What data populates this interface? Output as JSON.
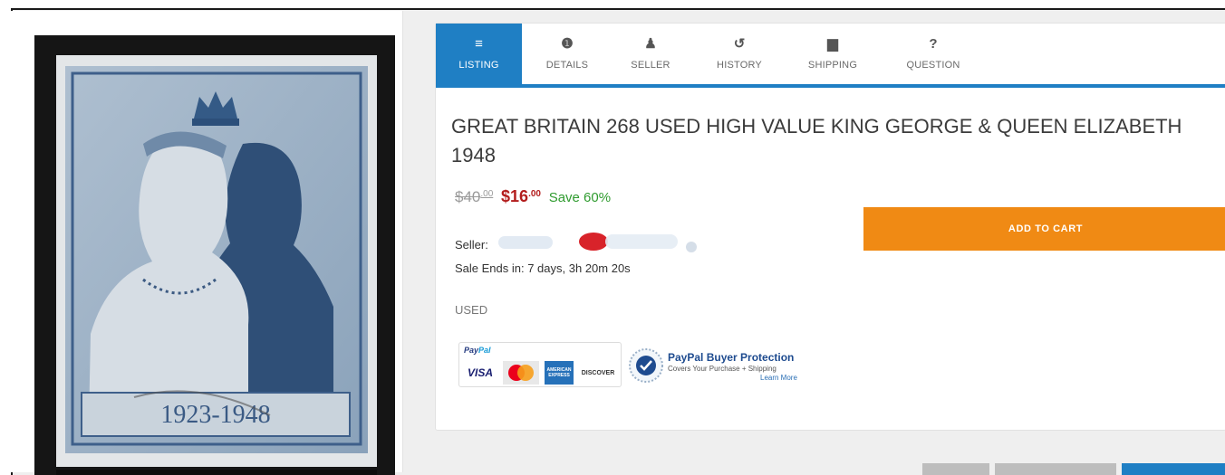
{
  "tabs": [
    {
      "label": "LISTING",
      "icon": "list-icon",
      "glyph": "≡"
    },
    {
      "label": "DETAILS",
      "icon": "info-icon",
      "glyph": "❶"
    },
    {
      "label": "SELLER",
      "icon": "person-icon",
      "glyph": "♟"
    },
    {
      "label": "HISTORY",
      "icon": "history-icon",
      "glyph": "↺"
    },
    {
      "label": "SHIPPING",
      "icon": "truck-icon",
      "glyph": "▆"
    },
    {
      "label": "QUESTION",
      "icon": "question-icon",
      "glyph": "?"
    }
  ],
  "listing": {
    "title": "GREAT BRITAIN 268 USED HIGH VALUE KING GEORGE & QUEEN ELIZABETH 1948",
    "old_price_main": "$40",
    "old_price_cents": ".00",
    "new_price_main": "$16",
    "new_price_cents": ".00",
    "save_text": "Save 60%",
    "seller_label": "Seller:",
    "sale_ends": "Sale Ends in: 7 days, 3h 20m 20s",
    "condition": "USED",
    "add_to_cart": "ADD TO CART"
  },
  "payment": {
    "paypal_small_1": "Pay",
    "paypal_small_2": "Pal",
    "visa": "VISA",
    "amex": "AMERICAN EXPRESS",
    "discover": "DISCOVER",
    "protection_title": "PayPal Buyer Protection",
    "protection_sub": "Covers Your Purchase + Shipping",
    "learn_more": "Learn More"
  },
  "stamp": {
    "years": "1923-1948"
  },
  "colors": {
    "accent_blue": "#1f7fc4",
    "cart_orange": "#f08a14",
    "price_red": "#b31d1d",
    "save_green": "#2f9b2f"
  }
}
